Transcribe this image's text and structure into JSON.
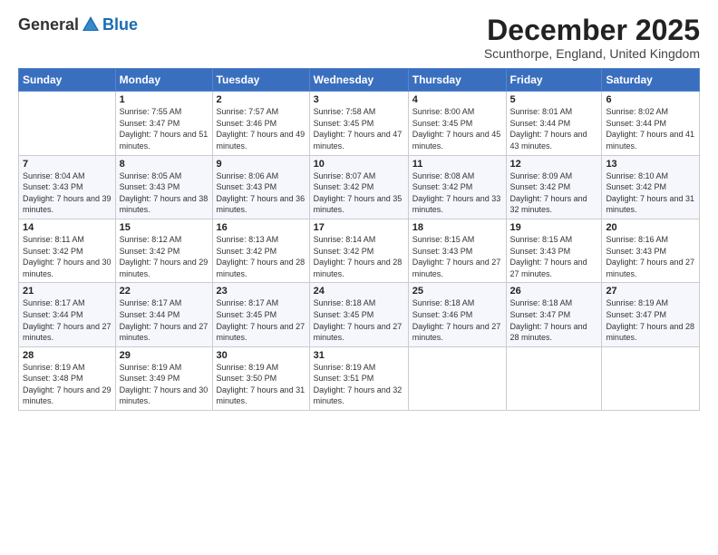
{
  "logo": {
    "general": "General",
    "blue": "Blue"
  },
  "title": "December 2025",
  "location": "Scunthorpe, England, United Kingdom",
  "headers": [
    "Sunday",
    "Monday",
    "Tuesday",
    "Wednesday",
    "Thursday",
    "Friday",
    "Saturday"
  ],
  "weeks": [
    [
      {
        "day": "",
        "sunrise": "",
        "sunset": "",
        "daylight": ""
      },
      {
        "day": "1",
        "sunrise": "Sunrise: 7:55 AM",
        "sunset": "Sunset: 3:47 PM",
        "daylight": "Daylight: 7 hours and 51 minutes."
      },
      {
        "day": "2",
        "sunrise": "Sunrise: 7:57 AM",
        "sunset": "Sunset: 3:46 PM",
        "daylight": "Daylight: 7 hours and 49 minutes."
      },
      {
        "day": "3",
        "sunrise": "Sunrise: 7:58 AM",
        "sunset": "Sunset: 3:45 PM",
        "daylight": "Daylight: 7 hours and 47 minutes."
      },
      {
        "day": "4",
        "sunrise": "Sunrise: 8:00 AM",
        "sunset": "Sunset: 3:45 PM",
        "daylight": "Daylight: 7 hours and 45 minutes."
      },
      {
        "day": "5",
        "sunrise": "Sunrise: 8:01 AM",
        "sunset": "Sunset: 3:44 PM",
        "daylight": "Daylight: 7 hours and 43 minutes."
      },
      {
        "day": "6",
        "sunrise": "Sunrise: 8:02 AM",
        "sunset": "Sunset: 3:44 PM",
        "daylight": "Daylight: 7 hours and 41 minutes."
      }
    ],
    [
      {
        "day": "7",
        "sunrise": "Sunrise: 8:04 AM",
        "sunset": "Sunset: 3:43 PM",
        "daylight": "Daylight: 7 hours and 39 minutes."
      },
      {
        "day": "8",
        "sunrise": "Sunrise: 8:05 AM",
        "sunset": "Sunset: 3:43 PM",
        "daylight": "Daylight: 7 hours and 38 minutes."
      },
      {
        "day": "9",
        "sunrise": "Sunrise: 8:06 AM",
        "sunset": "Sunset: 3:43 PM",
        "daylight": "Daylight: 7 hours and 36 minutes."
      },
      {
        "day": "10",
        "sunrise": "Sunrise: 8:07 AM",
        "sunset": "Sunset: 3:42 PM",
        "daylight": "Daylight: 7 hours and 35 minutes."
      },
      {
        "day": "11",
        "sunrise": "Sunrise: 8:08 AM",
        "sunset": "Sunset: 3:42 PM",
        "daylight": "Daylight: 7 hours and 33 minutes."
      },
      {
        "day": "12",
        "sunrise": "Sunrise: 8:09 AM",
        "sunset": "Sunset: 3:42 PM",
        "daylight": "Daylight: 7 hours and 32 minutes."
      },
      {
        "day": "13",
        "sunrise": "Sunrise: 8:10 AM",
        "sunset": "Sunset: 3:42 PM",
        "daylight": "Daylight: 7 hours and 31 minutes."
      }
    ],
    [
      {
        "day": "14",
        "sunrise": "Sunrise: 8:11 AM",
        "sunset": "Sunset: 3:42 PM",
        "daylight": "Daylight: 7 hours and 30 minutes."
      },
      {
        "day": "15",
        "sunrise": "Sunrise: 8:12 AM",
        "sunset": "Sunset: 3:42 PM",
        "daylight": "Daylight: 7 hours and 29 minutes."
      },
      {
        "day": "16",
        "sunrise": "Sunrise: 8:13 AM",
        "sunset": "Sunset: 3:42 PM",
        "daylight": "Daylight: 7 hours and 28 minutes."
      },
      {
        "day": "17",
        "sunrise": "Sunrise: 8:14 AM",
        "sunset": "Sunset: 3:42 PM",
        "daylight": "Daylight: 7 hours and 28 minutes."
      },
      {
        "day": "18",
        "sunrise": "Sunrise: 8:15 AM",
        "sunset": "Sunset: 3:43 PM",
        "daylight": "Daylight: 7 hours and 27 minutes."
      },
      {
        "day": "19",
        "sunrise": "Sunrise: 8:15 AM",
        "sunset": "Sunset: 3:43 PM",
        "daylight": "Daylight: 7 hours and 27 minutes."
      },
      {
        "day": "20",
        "sunrise": "Sunrise: 8:16 AM",
        "sunset": "Sunset: 3:43 PM",
        "daylight": "Daylight: 7 hours and 27 minutes."
      }
    ],
    [
      {
        "day": "21",
        "sunrise": "Sunrise: 8:17 AM",
        "sunset": "Sunset: 3:44 PM",
        "daylight": "Daylight: 7 hours and 27 minutes."
      },
      {
        "day": "22",
        "sunrise": "Sunrise: 8:17 AM",
        "sunset": "Sunset: 3:44 PM",
        "daylight": "Daylight: 7 hours and 27 minutes."
      },
      {
        "day": "23",
        "sunrise": "Sunrise: 8:17 AM",
        "sunset": "Sunset: 3:45 PM",
        "daylight": "Daylight: 7 hours and 27 minutes."
      },
      {
        "day": "24",
        "sunrise": "Sunrise: 8:18 AM",
        "sunset": "Sunset: 3:45 PM",
        "daylight": "Daylight: 7 hours and 27 minutes."
      },
      {
        "day": "25",
        "sunrise": "Sunrise: 8:18 AM",
        "sunset": "Sunset: 3:46 PM",
        "daylight": "Daylight: 7 hours and 27 minutes."
      },
      {
        "day": "26",
        "sunrise": "Sunrise: 8:18 AM",
        "sunset": "Sunset: 3:47 PM",
        "daylight": "Daylight: 7 hours and 28 minutes."
      },
      {
        "day": "27",
        "sunrise": "Sunrise: 8:19 AM",
        "sunset": "Sunset: 3:47 PM",
        "daylight": "Daylight: 7 hours and 28 minutes."
      }
    ],
    [
      {
        "day": "28",
        "sunrise": "Sunrise: 8:19 AM",
        "sunset": "Sunset: 3:48 PM",
        "daylight": "Daylight: 7 hours and 29 minutes."
      },
      {
        "day": "29",
        "sunrise": "Sunrise: 8:19 AM",
        "sunset": "Sunset: 3:49 PM",
        "daylight": "Daylight: 7 hours and 30 minutes."
      },
      {
        "day": "30",
        "sunrise": "Sunrise: 8:19 AM",
        "sunset": "Sunset: 3:50 PM",
        "daylight": "Daylight: 7 hours and 31 minutes."
      },
      {
        "day": "31",
        "sunrise": "Sunrise: 8:19 AM",
        "sunset": "Sunset: 3:51 PM",
        "daylight": "Daylight: 7 hours and 32 minutes."
      },
      {
        "day": "",
        "sunrise": "",
        "sunset": "",
        "daylight": ""
      },
      {
        "day": "",
        "sunrise": "",
        "sunset": "",
        "daylight": ""
      },
      {
        "day": "",
        "sunrise": "",
        "sunset": "",
        "daylight": ""
      }
    ]
  ]
}
